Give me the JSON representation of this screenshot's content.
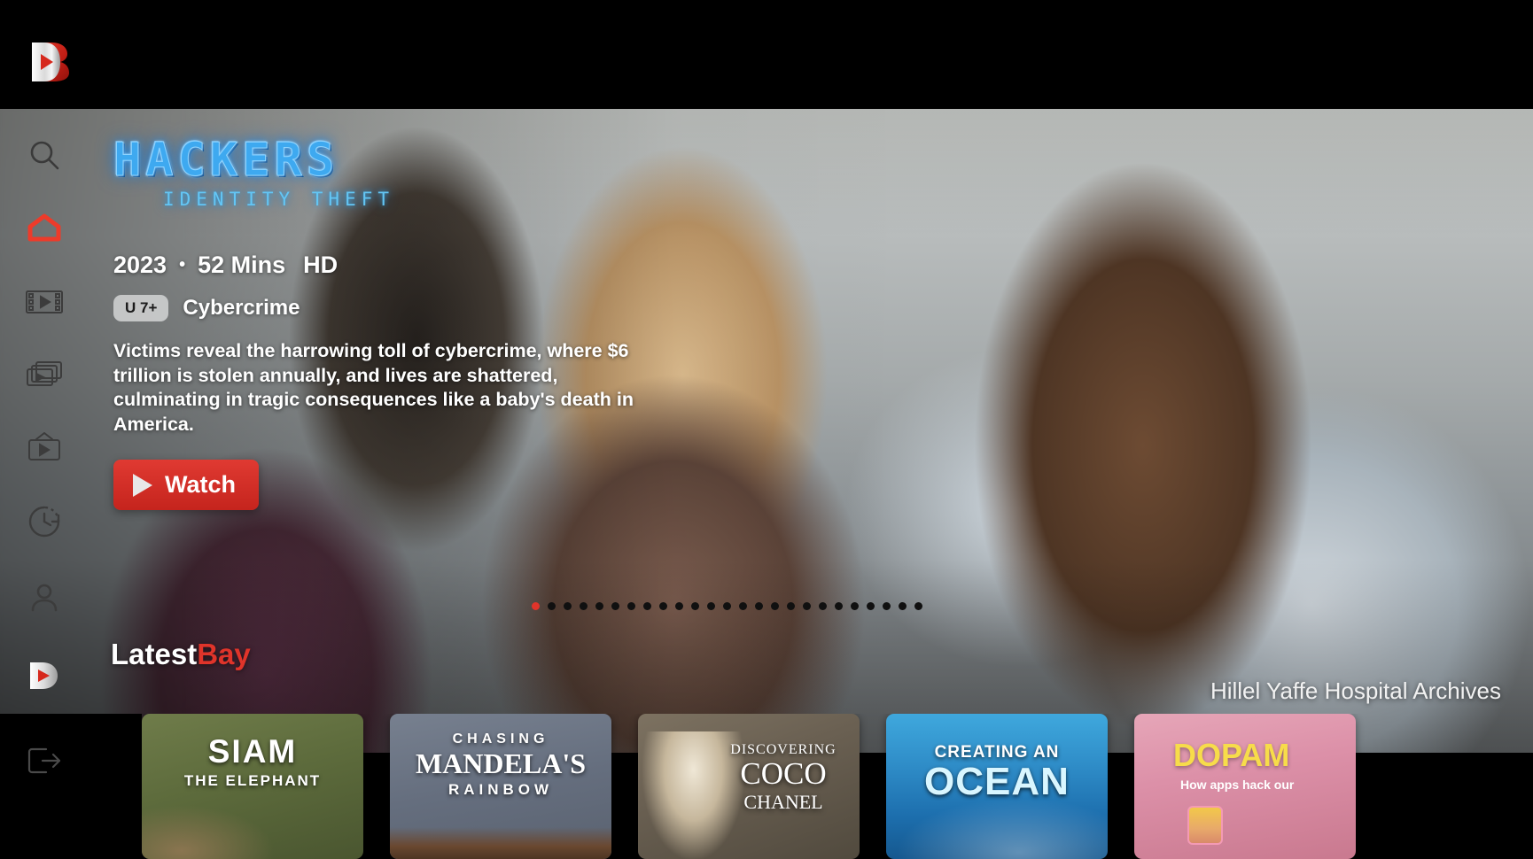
{
  "app": {
    "brand": "Bay",
    "logo_icon": "bay-play-logo"
  },
  "sidebar": {
    "items": [
      {
        "name": "search",
        "icon": "search-icon",
        "label": "Search",
        "active": false
      },
      {
        "name": "home",
        "icon": "home-icon",
        "label": "Home",
        "active": true
      },
      {
        "name": "movies",
        "icon": "film-strip-icon",
        "label": "Movies",
        "active": false
      },
      {
        "name": "series",
        "icon": "stacked-cards-icon",
        "label": "Series",
        "active": false
      },
      {
        "name": "live-tv",
        "icon": "tv-icon",
        "label": "Live TV",
        "active": false
      },
      {
        "name": "history",
        "icon": "clock-history-icon",
        "label": "History",
        "active": false
      },
      {
        "name": "profile",
        "icon": "person-icon",
        "label": "Profile",
        "active": false
      },
      {
        "name": "bay-play",
        "icon": "play-badge-icon",
        "label": "Bay Play",
        "active": false
      },
      {
        "name": "logout",
        "icon": "logout-icon",
        "label": "Log out",
        "active": false
      }
    ]
  },
  "hero": {
    "title_main": "HACKERS",
    "title_sub": "IDENTITY THEFT",
    "year": "2023",
    "separator": "•",
    "duration": "52 Mins",
    "quality": "HD",
    "rating": "U 7+",
    "genre": "Cybercrime",
    "synopsis": "Victims reveal the harrowing toll of cybercrime, where $6 trillion is stolen annually, and lives are shattered, culminating in tragic consequences like a baby's death in America.",
    "watch_label": "Watch",
    "watch_icon": "play-triangle-icon",
    "attribution": "Hillel Yaffe Hospital Archives",
    "carousel": {
      "total": 25,
      "active_index": 0
    },
    "colors": {
      "accent": "#e0342a",
      "title_glow": "#3ea9f0"
    }
  },
  "latest": {
    "title_prefix": "Latest",
    "title_accent": "Bay",
    "cards": [
      {
        "id": "siam",
        "line1": "SIAM",
        "line2": "THE ELEPHANT",
        "line3": ""
      },
      {
        "id": "mandela",
        "line1": "CHASING",
        "line2": "MANDELA'S",
        "line3": "RAINBOW"
      },
      {
        "id": "coco",
        "line1": "DISCOVERING",
        "line2": "COCO",
        "line3": "CHANEL"
      },
      {
        "id": "ocean",
        "line1": "CREATING AN",
        "line2": "OCEAN",
        "line3": ""
      },
      {
        "id": "dopamine",
        "line1": "DOPAM",
        "line2": "How apps hack our",
        "line3": ""
      }
    ]
  }
}
